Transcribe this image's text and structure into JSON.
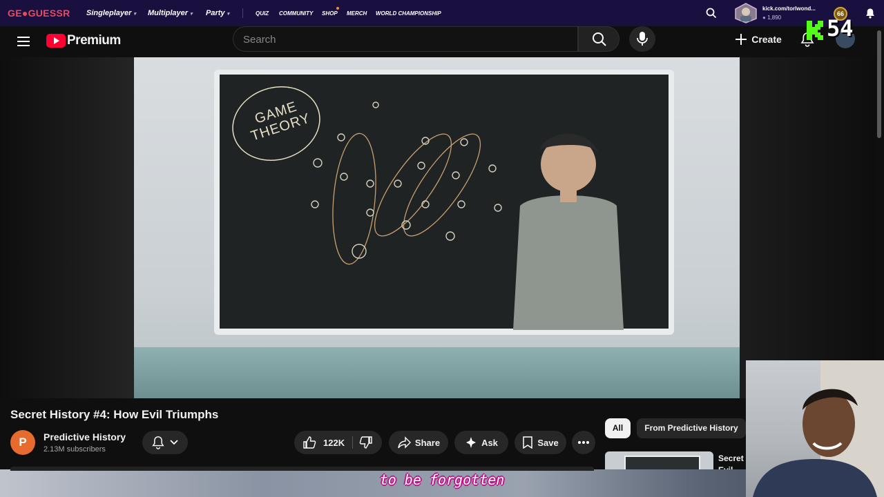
{
  "geoguessr": {
    "logo": "GE●GUESSR",
    "nav": [
      "Singleplayer",
      "Multiplayer",
      "Party"
    ],
    "links": [
      "QUIZ",
      "COMMUNITY",
      "SHOP",
      "MERCH",
      "WORLD CHAMPIONSHIP"
    ],
    "username": "kick.com/torlwond...",
    "coins": "1,890",
    "level": "66"
  },
  "youtube": {
    "brand": "Premium",
    "search_placeholder": "Search",
    "create_label": "Create"
  },
  "overlay": {
    "kick_count": "54"
  },
  "video": {
    "title": "Secret History #4: How Evil Triumphs",
    "channel_name": "Predictive History",
    "channel_initial": "P",
    "subscribers": "2.13M subscribers",
    "likes": "122K",
    "share_label": "Share",
    "ask_label": "Ask",
    "save_label": "Save",
    "board_heading": "GAME THEORY",
    "subtitle": "to be forgotten"
  },
  "recommendations": {
    "chips": [
      "All",
      "From Predictive History"
    ],
    "first_title": "Secret Evil"
  },
  "colors": {
    "geo_bg": "#1a1040",
    "yt_red": "#ff0033",
    "kick_green": "#53fc18",
    "channel_avatar": "#e56b2e",
    "subtitle_outline": "#c0158a"
  }
}
